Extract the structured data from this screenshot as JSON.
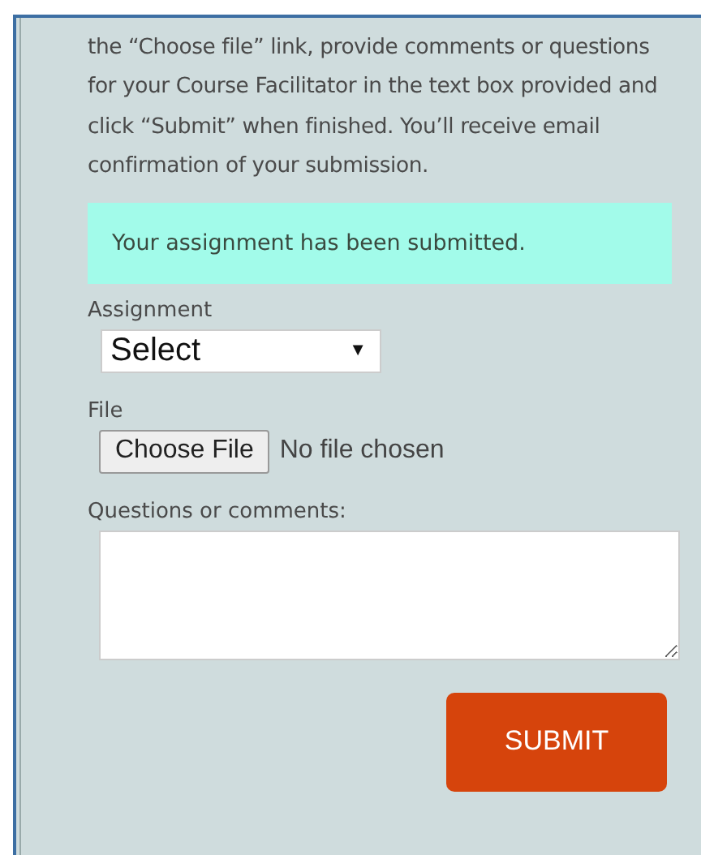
{
  "instructions": "the “Choose file” link, provide comments or questions for your Course Facilitator in the text box provided and click “Submit” when finished. You’ll receive email confirmation of your submission.",
  "alert": "Your assignment has been submitted.",
  "assignment": {
    "label": "Assignment",
    "value": "Select",
    "caret": "▼"
  },
  "file": {
    "label": "File",
    "button": "Choose File",
    "status": "No file chosen"
  },
  "comments": {
    "label": "Questions or comments:"
  },
  "submit": "SUBMIT"
}
